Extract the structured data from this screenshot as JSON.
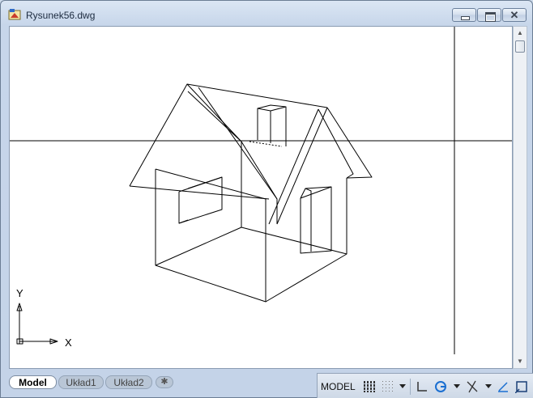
{
  "window": {
    "title": "Rysunek56.dwg",
    "minimize_label": "",
    "maximize_label": "",
    "close_label": "✕"
  },
  "ucs": {
    "x_label": "X",
    "y_label": "Y"
  },
  "tabs": {
    "model": "Model",
    "layout1": "Układ1",
    "layout2": "Układ2",
    "add": "✱"
  },
  "statusbar": {
    "space_label": "MODEL"
  },
  "icons": {
    "app": "autocad-drawing-icon",
    "grid": "grid-display-icon",
    "snap": "snap-mode-icon",
    "ortho": "ortho-mode-icon",
    "polar": "polar-tracking-icon",
    "osnap": "object-snap-icon",
    "dynucs": "dynamic-ucs-icon",
    "viewport": "viewport-icon"
  },
  "colors": {
    "accent": "#1a6fd1",
    "drawing_line": "#000000",
    "background": "#ffffff"
  }
}
